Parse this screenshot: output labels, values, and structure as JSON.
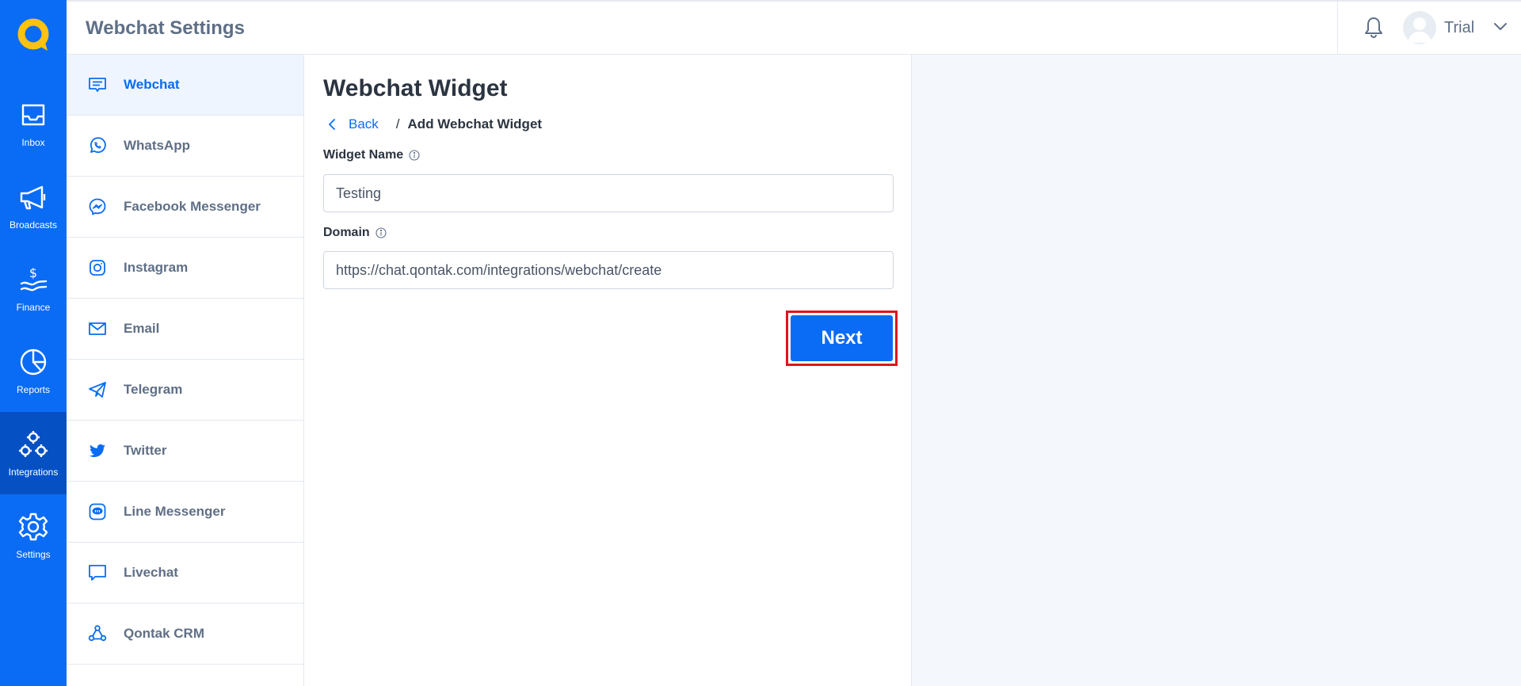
{
  "colors": {
    "brand": "#0a6cf5",
    "brand_dark": "#0551c4",
    "logo_yellow": "#ffc20e",
    "highlight": "#e0141e"
  },
  "nav": {
    "logo_icon": "qontak-logo",
    "items": [
      {
        "label": "Inbox",
        "icon": "inbox-icon",
        "active": false
      },
      {
        "label": "Broadcasts",
        "icon": "megaphone-icon",
        "active": false
      },
      {
        "label": "Finance",
        "icon": "finance-icon",
        "active": false
      },
      {
        "label": "Reports",
        "icon": "pie-chart-icon",
        "active": false
      },
      {
        "label": "Integrations",
        "icon": "integrations-icon",
        "active": true
      },
      {
        "label": "Settings",
        "icon": "gear-icon",
        "active": false
      }
    ]
  },
  "header": {
    "title": "Webchat Settings",
    "user_name": "Trial"
  },
  "sidebar": {
    "items": [
      {
        "label": "Webchat",
        "icon": "webchat-icon",
        "active": true
      },
      {
        "label": "WhatsApp",
        "icon": "whatsapp-icon",
        "active": false
      },
      {
        "label": "Facebook Messenger",
        "icon": "messenger-icon",
        "active": false
      },
      {
        "label": "Instagram",
        "icon": "instagram-icon",
        "active": false
      },
      {
        "label": "Email",
        "icon": "email-icon",
        "active": false
      },
      {
        "label": "Telegram",
        "icon": "telegram-icon",
        "active": false
      },
      {
        "label": "Twitter",
        "icon": "twitter-icon",
        "active": false
      },
      {
        "label": "Line Messenger",
        "icon": "line-icon",
        "active": false
      },
      {
        "label": "Livechat",
        "icon": "livechat-icon",
        "active": false
      },
      {
        "label": "Qontak CRM",
        "icon": "crm-icon",
        "active": false
      }
    ]
  },
  "main": {
    "title": "Webchat Widget",
    "breadcrumb": {
      "back": "Back",
      "separator": "/",
      "current": "Add Webchat Widget"
    },
    "widget_name": {
      "label": "Widget Name",
      "value": "Testing"
    },
    "domain": {
      "label": "Domain",
      "value": "https://chat.qontak.com/integrations/webchat/create"
    },
    "next_label": "Next"
  }
}
